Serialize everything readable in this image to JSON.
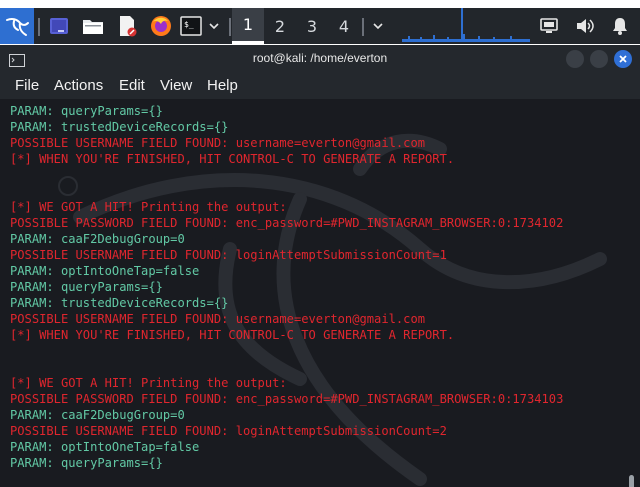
{
  "taskbar": {
    "workspaces": [
      "1",
      "2",
      "3",
      "4"
    ],
    "active_workspace": "1",
    "icons": [
      "kali-menu-icon",
      "desktop-icon",
      "file-manager-icon",
      "text-editor-icon",
      "firefox-icon",
      "terminal-icon",
      "chevron-down-icon",
      "cpu-graph",
      "screen-icon",
      "volume-icon",
      "bell-icon"
    ]
  },
  "window": {
    "title": "root@kali: /home/everton",
    "menu": [
      "File",
      "Actions",
      "Edit",
      "View",
      "Help"
    ]
  },
  "terminal": {
    "lines": [
      {
        "text": "PARAM: queryParams={}",
        "color": "green"
      },
      {
        "text": "PARAM: trustedDeviceRecords={}",
        "color": "green"
      },
      {
        "text": "POSSIBLE USERNAME FIELD FOUND: username=everton@gmail.com",
        "color": "red"
      },
      {
        "text": "[*] WHEN YOU'RE FINISHED, HIT CONTROL-C TO GENERATE A REPORT.",
        "color": "red"
      },
      {
        "text": "",
        "color": "green"
      },
      {
        "text": "",
        "color": "green"
      },
      {
        "text": "[*] WE GOT A HIT! Printing the output:",
        "color": "red"
      },
      {
        "text": "POSSIBLE PASSWORD FIELD FOUND: enc_password=#PWD_INSTAGRAM_BROWSER:0:1734102",
        "color": "red"
      },
      {
        "text": "PARAM: caaF2DebugGroup=0",
        "color": "green"
      },
      {
        "text": "POSSIBLE USERNAME FIELD FOUND: loginAttemptSubmissionCount=1",
        "color": "red"
      },
      {
        "text": "PARAM: optIntoOneTap=false",
        "color": "green"
      },
      {
        "text": "PARAM: queryParams={}",
        "color": "green"
      },
      {
        "text": "PARAM: trustedDeviceRecords={}",
        "color": "green"
      },
      {
        "text": "POSSIBLE USERNAME FIELD FOUND: username=everton@gmail.com",
        "color": "red"
      },
      {
        "text": "[*] WHEN YOU'RE FINISHED, HIT CONTROL-C TO GENERATE A REPORT.",
        "color": "red"
      },
      {
        "text": "",
        "color": "green"
      },
      {
        "text": "",
        "color": "green"
      },
      {
        "text": "[*] WE GOT A HIT! Printing the output:",
        "color": "red"
      },
      {
        "text": "POSSIBLE PASSWORD FIELD FOUND: enc_password=#PWD_INSTAGRAM_BROWSER:0:1734103",
        "color": "red"
      },
      {
        "text": "PARAM: caaF2DebugGroup=0",
        "color": "green"
      },
      {
        "text": "POSSIBLE USERNAME FIELD FOUND: loginAttemptSubmissionCount=2",
        "color": "red"
      },
      {
        "text": "PARAM: optIntoOneTap=false",
        "color": "green"
      },
      {
        "text": "PARAM: queryParams={}",
        "color": "green"
      }
    ]
  },
  "colors": {
    "red": "#e0262e",
    "green": "#62c9a5",
    "terminal_bg": "#191b20",
    "taskbar_bg": "#22262b",
    "close_button": "#2f6fd6"
  }
}
